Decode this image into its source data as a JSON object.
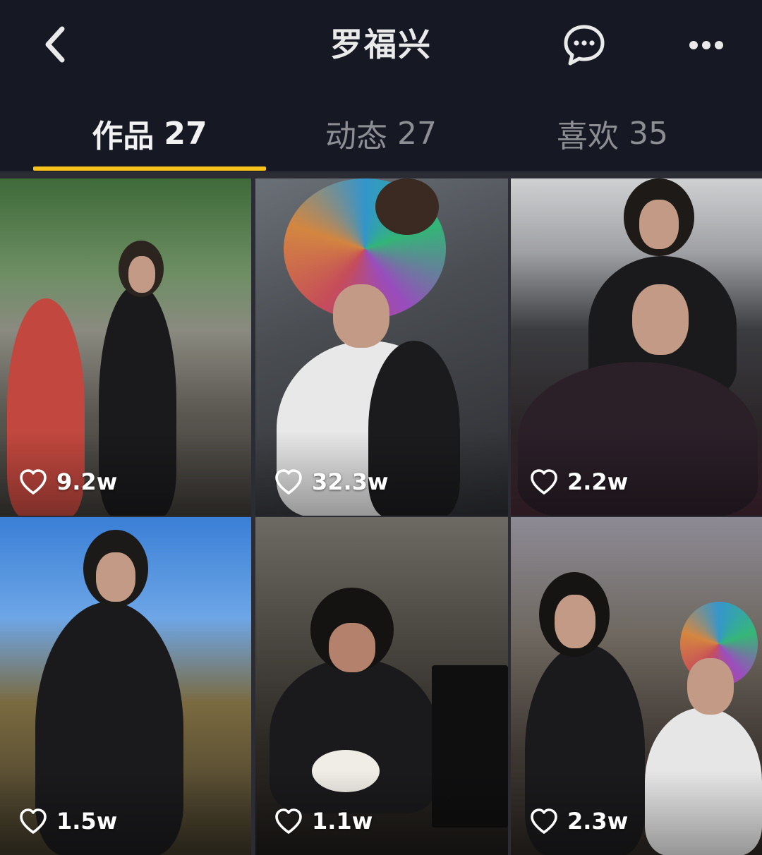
{
  "header": {
    "title": "罗福兴"
  },
  "tabs": [
    {
      "label": "作品",
      "count": "27",
      "active": true
    },
    {
      "label": "动态",
      "count": "27",
      "active": false
    },
    {
      "label": "喜欢",
      "count": "35",
      "active": false
    }
  ],
  "colors": {
    "background": "#161823",
    "tab_indicator": "#f8c21b",
    "inactive_tab": "#8d8e94"
  },
  "videos": [
    {
      "likes": "9.2w"
    },
    {
      "likes": "32.3w"
    },
    {
      "likes": "2.2w"
    },
    {
      "likes": "1.5w"
    },
    {
      "likes": "1.1w"
    },
    {
      "likes": "2.3w"
    }
  ],
  "icons": {
    "back": "chevron-left-icon",
    "chat": "chat-bubble-icon",
    "more": "more-dots-icon",
    "like": "heart-outline-icon"
  }
}
